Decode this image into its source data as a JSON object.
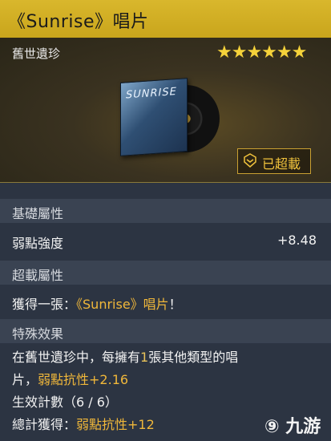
{
  "title": "《Sunrise》唱片",
  "rarity": "舊世遺珍",
  "stars": "★★★★★★",
  "star_color": "#f5d23a",
  "item_art_text": "SUNRISE",
  "overclock_label": "已超載",
  "sections": {
    "base_attr": {
      "header": "基礎屬性",
      "rows": [
        {
          "label": "弱點強度",
          "value": "+8.48"
        }
      ]
    },
    "overload_attr": {
      "header": "超載屬性",
      "line_prefix": "獲得一張：",
      "line_item": "《Sunrise》唱片",
      "line_suffix": "！"
    },
    "special_effect": {
      "header": "特殊效果",
      "line1_a": "在舊世遺珍中，每擁有",
      "line1_num": "1",
      "line1_b": "張其他類型的唱",
      "line2_a": "片，",
      "line2_stat": "弱點抗性+2.16",
      "line3": "生效計數（6 / 6）",
      "line4_a": "總計獲得：",
      "line4_stat": "弱點抗性+12"
    }
  },
  "watermark": "九游",
  "accent_gold": "#f0b73a"
}
